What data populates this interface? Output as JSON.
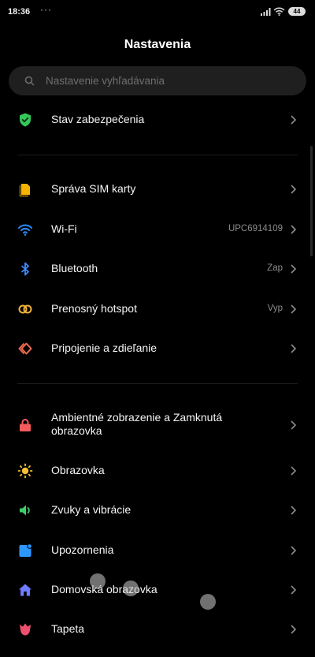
{
  "status": {
    "time": "18:36",
    "dots": "···",
    "battery": "44"
  },
  "title": "Nastavenia",
  "search": {
    "placeholder": "Nastavenie vyhľadávania"
  },
  "colors": {
    "security": "#34c759",
    "sim": "#f4b400",
    "wifi": "#2f8cff",
    "bluetooth": "#3d8bff",
    "hotspot": "#f1b33a",
    "connection": "#f16a50",
    "lockscreen": "#f25c5c",
    "display": "#f6c033",
    "sound": "#3ccf6a",
    "notifications": "#2e96ff",
    "home": "#6f7bff",
    "wallpaper": "#ef4f6d"
  },
  "items": [
    {
      "label": "Stav zabezpečenia",
      "icon": "shield-check-icon"
    },
    {
      "label": "Správa SIM karty",
      "icon": "sim-card-icon"
    },
    {
      "label": "Wi-Fi",
      "value": "UPC6914109",
      "icon": "wifi-icon"
    },
    {
      "label": "Bluetooth",
      "value": "Zap",
      "icon": "bluetooth-icon"
    },
    {
      "label": "Prenosný hotspot",
      "value": "Vyp",
      "icon": "hotspot-icon"
    },
    {
      "label": "Pripojenie a zdieľanie",
      "icon": "connection-sharing-icon"
    },
    {
      "label": "Ambientné zobrazenie a Zamknutá obrazovka",
      "icon": "lock-icon"
    },
    {
      "label": "Obrazovka",
      "icon": "sun-icon"
    },
    {
      "label": "Zvuky a vibrácie",
      "icon": "speaker-icon"
    },
    {
      "label": "Upozornenia",
      "icon": "notification-icon"
    },
    {
      "label": "Domovská obrazovka",
      "icon": "home-icon"
    },
    {
      "label": "Tapeta",
      "icon": "tulip-icon"
    }
  ]
}
